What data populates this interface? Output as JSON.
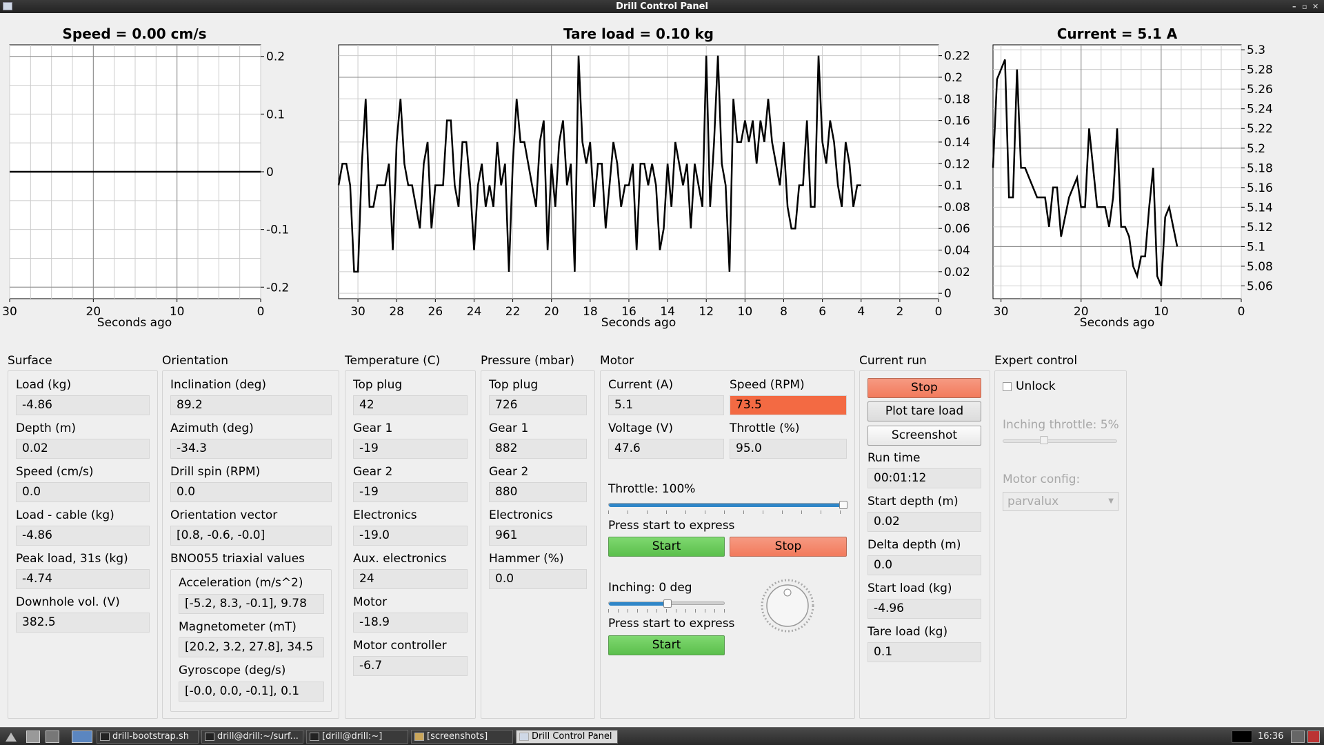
{
  "window": {
    "title": "Drill Control Panel"
  },
  "charts": {
    "speed": {
      "title": "Speed = 0.00 cm/s",
      "xlabel": "Seconds ago",
      "xticks": [
        "30",
        "20",
        "10",
        "0"
      ],
      "yticks": [
        "0.2",
        "0.1",
        "0",
        "-0.1",
        "-0.2"
      ]
    },
    "tare": {
      "title": "Tare load = 0.10 kg",
      "xlabel": "Seconds ago",
      "xticks": [
        "30",
        "28",
        "26",
        "24",
        "22",
        "20",
        "18",
        "16",
        "14",
        "12",
        "10",
        "8",
        "6",
        "4",
        "2",
        "0"
      ],
      "yticks": [
        "0.22",
        "0.2",
        "0.18",
        "0.16",
        "0.14",
        "0.12",
        "0.1",
        "0.08",
        "0.06",
        "0.04",
        "0.02",
        "0"
      ]
    },
    "current": {
      "title": "Current = 5.1 A",
      "xlabel": "Seconds ago",
      "xticks": [
        "30",
        "20",
        "10",
        "0"
      ],
      "yticks": [
        "5.3",
        "5.28",
        "5.26",
        "5.24",
        "5.22",
        "5.2",
        "5.18",
        "5.16",
        "5.14",
        "5.12",
        "5.1",
        "5.08",
        "5.06"
      ]
    }
  },
  "chart_data": [
    {
      "type": "line",
      "title": "Speed = 0.00 cm/s",
      "xlabel": "Seconds ago",
      "ylabel": "",
      "xlim": [
        30,
        0
      ],
      "ylim": [
        -0.22,
        0.22
      ],
      "x": [
        30,
        0
      ],
      "series": [
        {
          "values": [
            0,
            0
          ]
        }
      ],
      "grid": true
    },
    {
      "type": "line",
      "title": "Tare load = 0.10 kg",
      "xlabel": "Seconds ago",
      "ylabel": "",
      "xlim": [
        31,
        0
      ],
      "ylim": [
        -0.005,
        0.23
      ],
      "x": [
        31,
        30.8,
        30.6,
        30.4,
        30.2,
        30,
        29.8,
        29.6,
        29.4,
        29.2,
        29,
        28.8,
        28.6,
        28.4,
        28.2,
        28,
        27.8,
        27.6,
        27.4,
        27.2,
        27,
        26.8,
        26.6,
        26.4,
        26.2,
        26,
        25.8,
        25.6,
        25.4,
        25.2,
        25,
        24.8,
        24.6,
        24.4,
        24.2,
        24,
        23.8,
        23.6,
        23.4,
        23.2,
        23,
        22.8,
        22.6,
        22.4,
        22.2,
        22,
        21.8,
        21.6,
        21.4,
        21.2,
        21,
        20.8,
        20.6,
        20.4,
        20.2,
        20,
        19.8,
        19.6,
        19.4,
        19.2,
        19,
        18.8,
        18.6,
        18.4,
        18.2,
        18,
        17.8,
        17.6,
        17.4,
        17.2,
        17,
        16.8,
        16.6,
        16.4,
        16.2,
        16,
        15.8,
        15.6,
        15.4,
        15.2,
        15,
        14.8,
        14.6,
        14.4,
        14.2,
        14,
        13.8,
        13.6,
        13.4,
        13.2,
        13,
        12.8,
        12.6,
        12.4,
        12.2,
        12,
        11.8,
        11.6,
        11.4,
        11.2,
        11,
        10.8,
        10.6,
        10.4,
        10.2,
        10,
        9.8,
        9.6,
        9.4,
        9.2,
        9,
        8.8,
        8.6,
        8.4,
        8.2,
        8,
        7.8,
        7.6,
        7.4,
        7.2,
        7,
        6.8,
        6.6,
        6.4,
        6.2,
        6,
        5.8,
        5.6,
        5.4,
        5.2,
        5,
        4.8,
        4.6,
        4.4,
        4.2,
        4,
        3.8,
        3.6,
        3.4,
        3.2,
        3,
        2.8,
        2.6,
        2.4,
        2.2,
        2,
        1.8,
        1.6,
        1.4,
        1.2,
        1,
        0.8,
        0.6,
        0.4,
        0.2,
        0
      ],
      "series": [
        {
          "values": [
            0.1,
            0.12,
            0.12,
            0.1,
            0.02,
            0.02,
            0.12,
            0.18,
            0.08,
            0.08,
            0.1,
            0.1,
            0.1,
            0.12,
            0.04,
            0.14,
            0.18,
            0.12,
            0.1,
            0.1,
            0.08,
            0.06,
            0.12,
            0.14,
            0.06,
            0.1,
            0.1,
            0.1,
            0.16,
            0.16,
            0.1,
            0.08,
            0.14,
            0.14,
            0.1,
            0.04,
            0.1,
            0.12,
            0.08,
            0.1,
            0.08,
            0.14,
            0.1,
            0.12,
            0.02,
            0.12,
            0.18,
            0.14,
            0.14,
            0.12,
            0.1,
            0.08,
            0.14,
            0.16,
            0.04,
            0.12,
            0.08,
            0.14,
            0.16,
            0.1,
            0.12,
            0.02,
            0.22,
            0.14,
            0.12,
            0.14,
            0.08,
            0.12,
            0.12,
            0.06,
            0.1,
            0.14,
            0.12,
            0.08,
            0.1,
            0.1,
            0.12,
            0.04,
            0.12,
            0.12,
            0.1,
            0.12,
            0.1,
            0.04,
            0.06,
            0.12,
            0.08,
            0.14,
            0.12,
            0.1,
            0.12,
            0.06,
            0.12,
            0.1,
            0.08,
            0.22,
            0.08,
            0.14,
            0.22,
            0.12,
            0.1,
            0.02,
            0.18,
            0.14,
            0.14,
            0.16,
            0.14,
            0.16,
            0.12,
            0.16,
            0.14,
            0.18,
            0.14,
            0.12,
            0.1,
            0.14,
            0.08,
            0.06,
            0.06,
            0.1,
            0.1,
            0.16,
            0.08,
            0.08,
            0.22,
            0.14,
            0.12,
            0.16,
            0.14,
            0.1,
            0.08,
            0.14,
            0.12,
            0.08,
            0.1,
            0.1
          ]
        }
      ],
      "grid": true
    },
    {
      "type": "line",
      "title": "Current = 5.1 A",
      "xlabel": "Seconds ago",
      "ylabel": "",
      "xlim": [
        31,
        0
      ],
      "ylim": [
        5.047,
        5.305
      ],
      "x": [
        31,
        30.5,
        30,
        29.5,
        29,
        28.5,
        28,
        27.5,
        27,
        26.5,
        26,
        25.5,
        25,
        24.5,
        24,
        23.5,
        23,
        22.5,
        22,
        21.5,
        21,
        20.5,
        20,
        19.5,
        19,
        18.5,
        18,
        17.5,
        17,
        16.5,
        16,
        15.5,
        15,
        14.5,
        14,
        13.5,
        13,
        12.5,
        12,
        11.5,
        11,
        10.5,
        10,
        9.5,
        9,
        8.5,
        8,
        7.5,
        7,
        6.5,
        6,
        5.5,
        5,
        4.5,
        4,
        3.5,
        3,
        2.5,
        2,
        1.5,
        1,
        0.5,
        0
      ],
      "series": [
        {
          "values": [
            5.18,
            5.27,
            5.28,
            5.29,
            5.15,
            5.15,
            5.28,
            5.18,
            5.18,
            5.17,
            5.16,
            5.15,
            5.15,
            5.15,
            5.12,
            5.16,
            5.16,
            5.11,
            5.13,
            5.15,
            5.16,
            5.17,
            5.14,
            5.14,
            5.22,
            5.18,
            5.14,
            5.14,
            5.14,
            5.12,
            5.15,
            5.22,
            5.12,
            5.12,
            5.11,
            5.08,
            5.07,
            5.09,
            5.09,
            5.14,
            5.18,
            5.07,
            5.06,
            5.13,
            5.14,
            5.12,
            5.1
          ]
        }
      ],
      "grid": true
    }
  ],
  "surface": {
    "title": "Surface",
    "fields": [
      {
        "label": "Load (kg)",
        "value": "-4.86"
      },
      {
        "label": "Depth (m)",
        "value": "0.02"
      },
      {
        "label": "Speed (cm/s)",
        "value": "0.0"
      },
      {
        "label": "Load - cable (kg)",
        "value": "-4.86"
      },
      {
        "label": "Peak load, 31s (kg)",
        "value": "-4.74"
      },
      {
        "label": "Downhole vol. (V)",
        "value": "382.5"
      }
    ]
  },
  "orientation": {
    "title": "Orientation",
    "fields": [
      {
        "label": "Inclination (deg)",
        "value": "89.2"
      },
      {
        "label": "Azimuth (deg)",
        "value": "-34.3"
      },
      {
        "label": "Drill spin (RPM)",
        "value": "0.0"
      },
      {
        "label": "Orientation vector",
        "value": "[0.8, -0.6, -0.0]"
      }
    ],
    "bno_title": "BNO055 triaxial values",
    "bno": [
      {
        "label": "Acceleration (m/s^2)",
        "value": "[-5.2, 8.3, -0.1], 9.78"
      },
      {
        "label": "Magnetometer (mT)",
        "value": "[20.2, 3.2, 27.8], 34.5"
      },
      {
        "label": "Gyroscope (deg/s)",
        "value": "[-0.0, 0.0, -0.1], 0.1"
      }
    ]
  },
  "temperature": {
    "title": "Temperature (C)",
    "fields": [
      {
        "label": "Top plug",
        "value": "42"
      },
      {
        "label": "Gear 1",
        "value": "-19"
      },
      {
        "label": "Gear 2",
        "value": "-19"
      },
      {
        "label": "Electronics",
        "value": "-19.0"
      },
      {
        "label": "Aux. electronics",
        "value": "24"
      },
      {
        "label": "Motor",
        "value": "-18.9"
      },
      {
        "label": "Motor controller",
        "value": "-6.7"
      }
    ]
  },
  "pressure": {
    "title": "Pressure (mbar)",
    "fields": [
      {
        "label": "Top plug",
        "value": "726"
      },
      {
        "label": "Gear 1",
        "value": "882"
      },
      {
        "label": "Gear 2",
        "value": "880"
      },
      {
        "label": "Electronics",
        "value": "961"
      },
      {
        "label": "Hammer (%)",
        "value": "0.0"
      }
    ]
  },
  "motor": {
    "title": "Motor",
    "current_label": "Current (A)",
    "current": "5.1",
    "speed_label": "Speed (RPM)",
    "speed": "73.5",
    "voltage_label": "Voltage (V)",
    "voltage": "47.6",
    "throttle_label": "Throttle (%)",
    "throttle": "95.0",
    "throttle_slider_label": "Throttle: 100%",
    "throttle_level": 1.0,
    "press_start_1": "Press start to express",
    "start_1": "Start",
    "stop_1": "Stop",
    "inching_label": "Inching: 0 deg",
    "inching_level": 0.5,
    "press_start_2": "Press start to express",
    "start_2": "Start"
  },
  "run": {
    "title": "Current run",
    "stop": "Stop",
    "plot_tare": "Plot tare load",
    "screenshot": "Screenshot",
    "fields": [
      {
        "label": "Run time",
        "value": "00:01:12"
      },
      {
        "label": "Start depth (m)",
        "value": "0.02"
      },
      {
        "label": "Delta depth (m)",
        "value": "0.0"
      },
      {
        "label": "Start load (kg)",
        "value": "-4.96"
      },
      {
        "label": "Tare load (kg)",
        "value": "0.1"
      }
    ]
  },
  "expert": {
    "title": "Expert control",
    "unlock": "Unlock",
    "inching_throttle": "Inching throttle: 5%",
    "inching_throttle_level": 0.35,
    "motor_config_label": "Motor config:",
    "motor_config_value": "parvalux"
  },
  "taskbar": {
    "tasks": [
      "drill-bootstrap.sh",
      "drill@drill:~/surf...",
      "[drill@drill:~]",
      "[screenshots]",
      "Drill Control Panel"
    ],
    "clock": "16:36"
  },
  "colors": {
    "accent_blue": "#2f86c8",
    "start_green": "#5bbf4c",
    "stop_red": "#f27a5c",
    "speed_highlight": "#f36a43"
  }
}
